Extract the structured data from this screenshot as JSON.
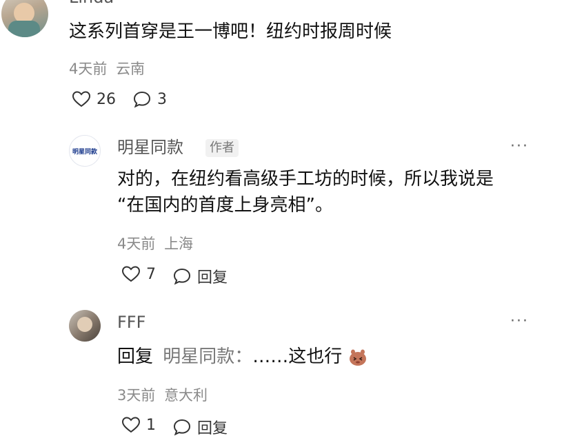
{
  "comments": [
    {
      "user": "Linda",
      "text": "这系列首穿是王一博吧！纽约时报周时候",
      "time": "4天前",
      "location": "云南",
      "likes": "26",
      "replies": "3"
    },
    {
      "user": "明星同款",
      "tag": "作者",
      "logo_text": "明星同款",
      "text_line1": "对的，在纽约看高级手工坊的时候，所以我说是",
      "text_line2": "“在国内的首度上身亮相”。",
      "time": "4天前",
      "location": "上海",
      "likes": "7",
      "reply_label": "回复"
    },
    {
      "user": "FFF",
      "reply_prefix": "回复",
      "mention": "明星同款：",
      "text": "……这也行",
      "time": "3天前",
      "location": "意大利",
      "likes": "1",
      "reply_label": "回复"
    }
  ],
  "more_label": "···",
  "icons": {
    "like": "heart-outline-icon",
    "comment": "speech-bubble-icon",
    "emoji": "shy-face-emoji-icon"
  }
}
